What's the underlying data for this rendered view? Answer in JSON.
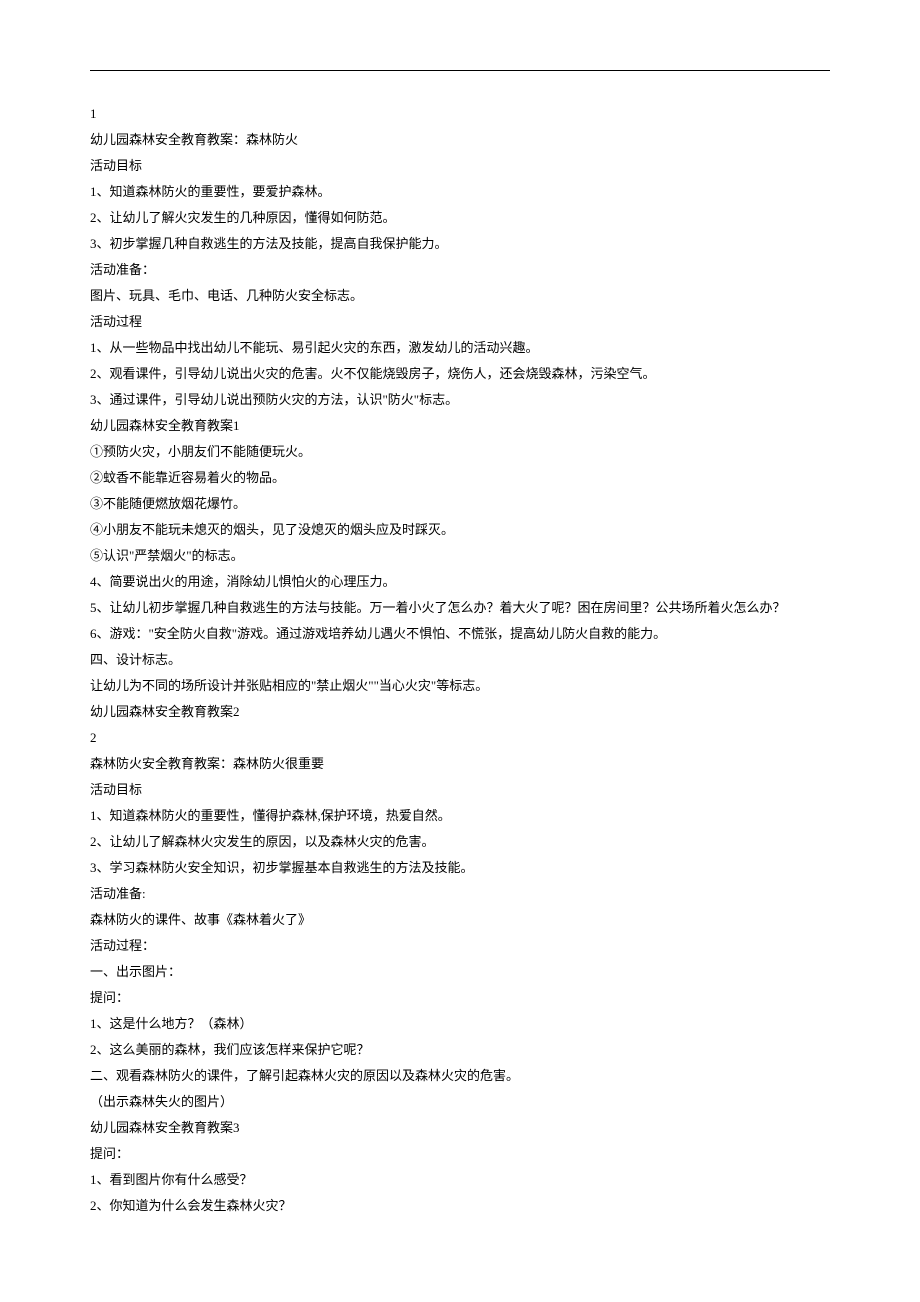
{
  "lines": [
    "1",
    "幼儿园森林安全教育教案：森林防火",
    "活动目标",
    "1、知道森林防火的重要性，要爱护森林。",
    "2、让幼儿了解火灾发生的几种原因，懂得如何防范。",
    "3、初步掌握几种自救逃生的方法及技能，提高自我保护能力。",
    "活动准备：",
    "图片、玩具、毛巾、电话、几种防火安全标志。",
    "活动过程",
    "1、从一些物品中找出幼儿不能玩、易引起火灾的东西，激发幼儿的活动兴趣。",
    "2、观看课件，引导幼儿说出火灾的危害。火不仅能烧毁房子，烧伤人，还会烧毁森林，污染空气。",
    "3、通过课件，引导幼儿说出预防火灾的方法，认识\"防火\"标志。",
    "幼儿园森林安全教育教案1",
    "①预防火灾，小朋友们不能随便玩火。",
    "②蚊香不能靠近容易着火的物品。",
    "③不能随便燃放烟花爆竹。",
    "④小朋友不能玩未熄灭的烟头，见了没熄灭的烟头应及时踩灭。",
    "⑤认识\"严禁烟火\"的标志。",
    "4、简要说出火的用途，消除幼儿惧怕火的心理压力。",
    "5、让幼儿初步掌握几种自救逃生的方法与技能。万一着小火了怎么办？着大火了呢？困在房间里？公共场所着火怎么办？",
    "6、游戏：\"安全防火自救\"游戏。通过游戏培养幼儿遇火不惧怕、不慌张，提高幼儿防火自救的能力。",
    "四、设计标志。",
    "让幼儿为不同的场所设计并张贴相应的\"禁止烟火\"\"当心火灾\"等标志。",
    "幼儿园森林安全教育教案2",
    "2",
    "森林防火安全教育教案：森林防火很重要",
    "活动目标",
    "1、知道森林防火的重要性，懂得护森林,保护环境，热爱自然。",
    "2、让幼儿了解森林火灾发生的原因，以及森林火灾的危害。",
    "3、学习森林防火安全知识，初步掌握基本自救逃生的方法及技能。",
    "活动准备:",
    "森林防火的课件、故事《森林着火了》",
    "活动过程：",
    "一、出示图片：",
    "提问：",
    "1、这是什么地方？（森林）",
    "2、这么美丽的森林，我们应该怎样来保护它呢？",
    "二、观看森林防火的课件，了解引起森林火灾的原因以及森林火灾的危害。",
    "（出示森林失火的图片）",
    "幼儿园森林安全教育教案3",
    "提问：",
    "1、看到图片你有什么感受？",
    "2、你知道为什么会发生森林火灾？"
  ]
}
